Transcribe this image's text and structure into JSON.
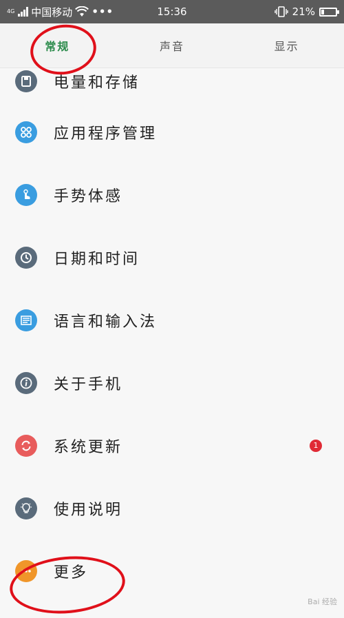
{
  "status_bar": {
    "network_tag": "4G",
    "carrier": "中国移动",
    "more": "•••",
    "time": "15:36",
    "battery_percent": "21%",
    "battery_level": 0.21
  },
  "tabs": [
    {
      "label": "常规",
      "active": true
    },
    {
      "label": "声音",
      "active": false
    },
    {
      "label": "显示",
      "active": false
    }
  ],
  "items": [
    {
      "label": "电量和存储",
      "icon": "storage-icon",
      "color": "#5a6b7b"
    },
    {
      "label": "应用程序管理",
      "icon": "apps-icon",
      "color": "#3a9de0"
    },
    {
      "label": "手势体感",
      "icon": "gesture-icon",
      "color": "#3a9de0"
    },
    {
      "label": "日期和时间",
      "icon": "clock-icon",
      "color": "#5a6b7b"
    },
    {
      "label": "语言和输入法",
      "icon": "keyboard-icon",
      "color": "#3a9de0"
    },
    {
      "label": "关于手机",
      "icon": "info-icon",
      "color": "#5a6b7b"
    },
    {
      "label": "系统更新",
      "icon": "update-icon",
      "color": "#e85c5c",
      "badge": "1"
    },
    {
      "label": "使用说明",
      "icon": "lightbulb-icon",
      "color": "#5a6b7b"
    },
    {
      "label": "更多",
      "icon": "more-icon",
      "color": "#f0962a"
    }
  ],
  "colors": {
    "active_tab": "#2a8a4a",
    "annotation_circle": "#e0101a",
    "badge": "#e02a35"
  },
  "watermark": "Bai 经验"
}
